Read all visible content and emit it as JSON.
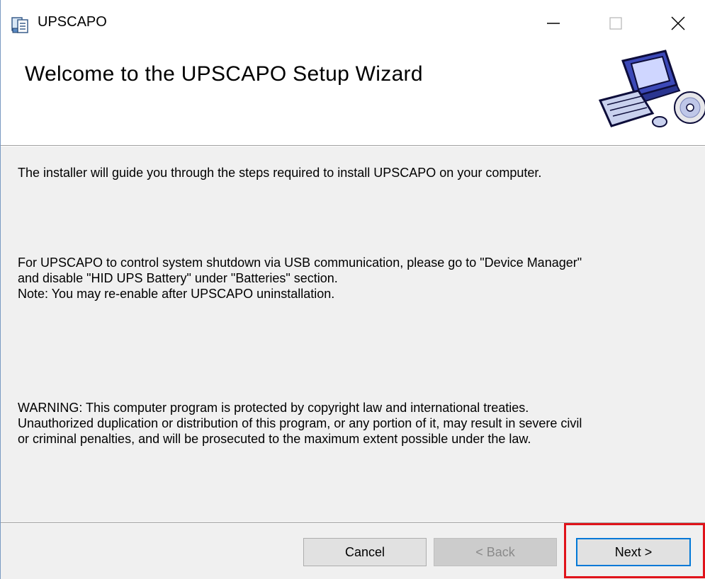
{
  "window": {
    "title": "UPSCAPO",
    "app_icon": "installer-icon",
    "controls": {
      "minimize_icon": "minimize-icon",
      "maximize_icon": "maximize-icon",
      "close_icon": "close-icon"
    }
  },
  "banner": {
    "heading": "Welcome to the UPSCAPO Setup Wizard",
    "art_icon": "computer-cd-icon"
  },
  "content": {
    "intro": "The installer will guide you through the steps required to install UPSCAPO on your computer.",
    "usb_note_line1": "For UPSCAPO to control system shutdown via USB communication, please go to \"Device Manager\"",
    "usb_note_line2": "and disable \"HID UPS Battery\" under \"Batteries\" section.",
    "usb_note_line3": "Note: You may re-enable after UPSCAPO uninstallation.",
    "warning_line1": "WARNING: This computer program is protected by copyright law and international treaties.",
    "warning_line2": "Unauthorized duplication or distribution of this program, or any portion of it, may result in severe civil",
    "warning_line3": "or criminal penalties, and will be prosecuted to the maximum extent possible under the law."
  },
  "buttons": {
    "cancel": "Cancel",
    "back": "< Back",
    "next": "Next >"
  },
  "colors": {
    "highlight": "#e0131a",
    "focus": "#0078d7"
  }
}
